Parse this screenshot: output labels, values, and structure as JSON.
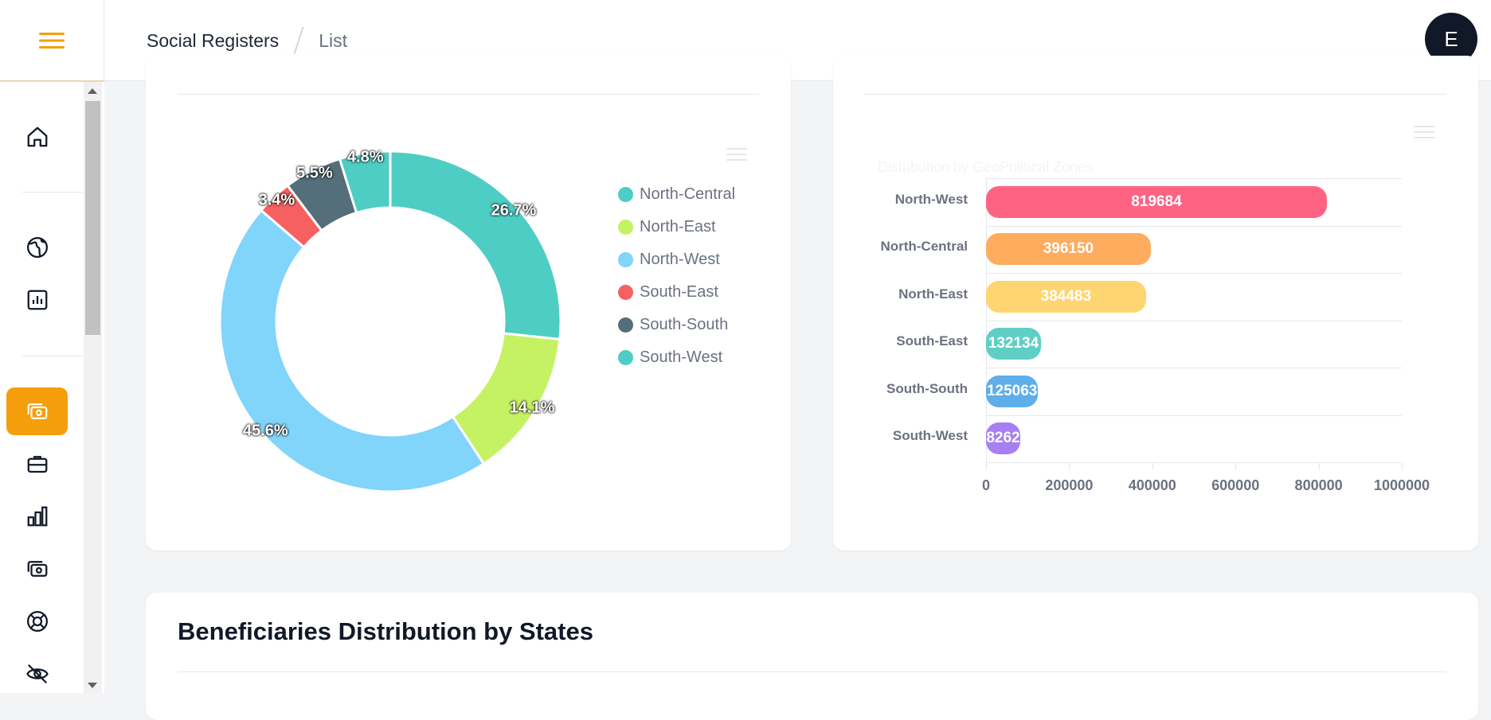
{
  "breadcrumb": {
    "root": "Social Registers",
    "current": "List"
  },
  "user": {
    "avatar_initial": "E"
  },
  "sidebar": {
    "items": [
      {
        "icon": "home-icon"
      },
      {
        "icon": "globe-icon"
      },
      {
        "icon": "report-icon"
      },
      {
        "icon": "money-icon",
        "active": true
      },
      {
        "icon": "briefcase-icon"
      },
      {
        "icon": "bar-chart-icon"
      },
      {
        "icon": "cash-icon"
      },
      {
        "icon": "lifebuoy-icon"
      },
      {
        "icon": "eye-off-icon"
      }
    ]
  },
  "colors": {
    "accent": "#f59e0b",
    "north_central": "#4ecdc4",
    "north_east": "#c5f263",
    "north_west": "#81d4fa",
    "south_east": "#f76060",
    "south_south": "#546e7a",
    "south_west": "#4ecdc4"
  },
  "chart_data": [
    {
      "type": "pie",
      "donut": true,
      "categories": [
        "North-Central",
        "North-East",
        "North-West",
        "South-East",
        "South-South",
        "South-West"
      ],
      "values": [
        26.7,
        14.1,
        45.6,
        3.4,
        5.5,
        4.8
      ],
      "labels": [
        "26.7%",
        "14.1%",
        "45.6%",
        "3.4%",
        "5.5%",
        "4.8%"
      ],
      "legend": "right"
    },
    {
      "type": "bar",
      "orientation": "horizontal",
      "title": "Distribution by GeoPolitical Zones",
      "categories": [
        "North-West",
        "North-Central",
        "North-East",
        "South-East",
        "South-South",
        "South-West"
      ],
      "values": [
        819684,
        396150,
        384483,
        132134,
        125063,
        8262
      ],
      "bar_colors": [
        "#ff6384",
        "#ffac5f",
        "#ffd572",
        "#5fcfc6",
        "#5eaeea",
        "#a77ff2"
      ],
      "xlim": [
        0,
        1000000
      ],
      "xticks": [
        "0",
        "200000",
        "400000",
        "600000",
        "800000",
        "1000000"
      ],
      "grid": true
    }
  ],
  "section": {
    "title": "Beneficiaries Distribution by States"
  }
}
